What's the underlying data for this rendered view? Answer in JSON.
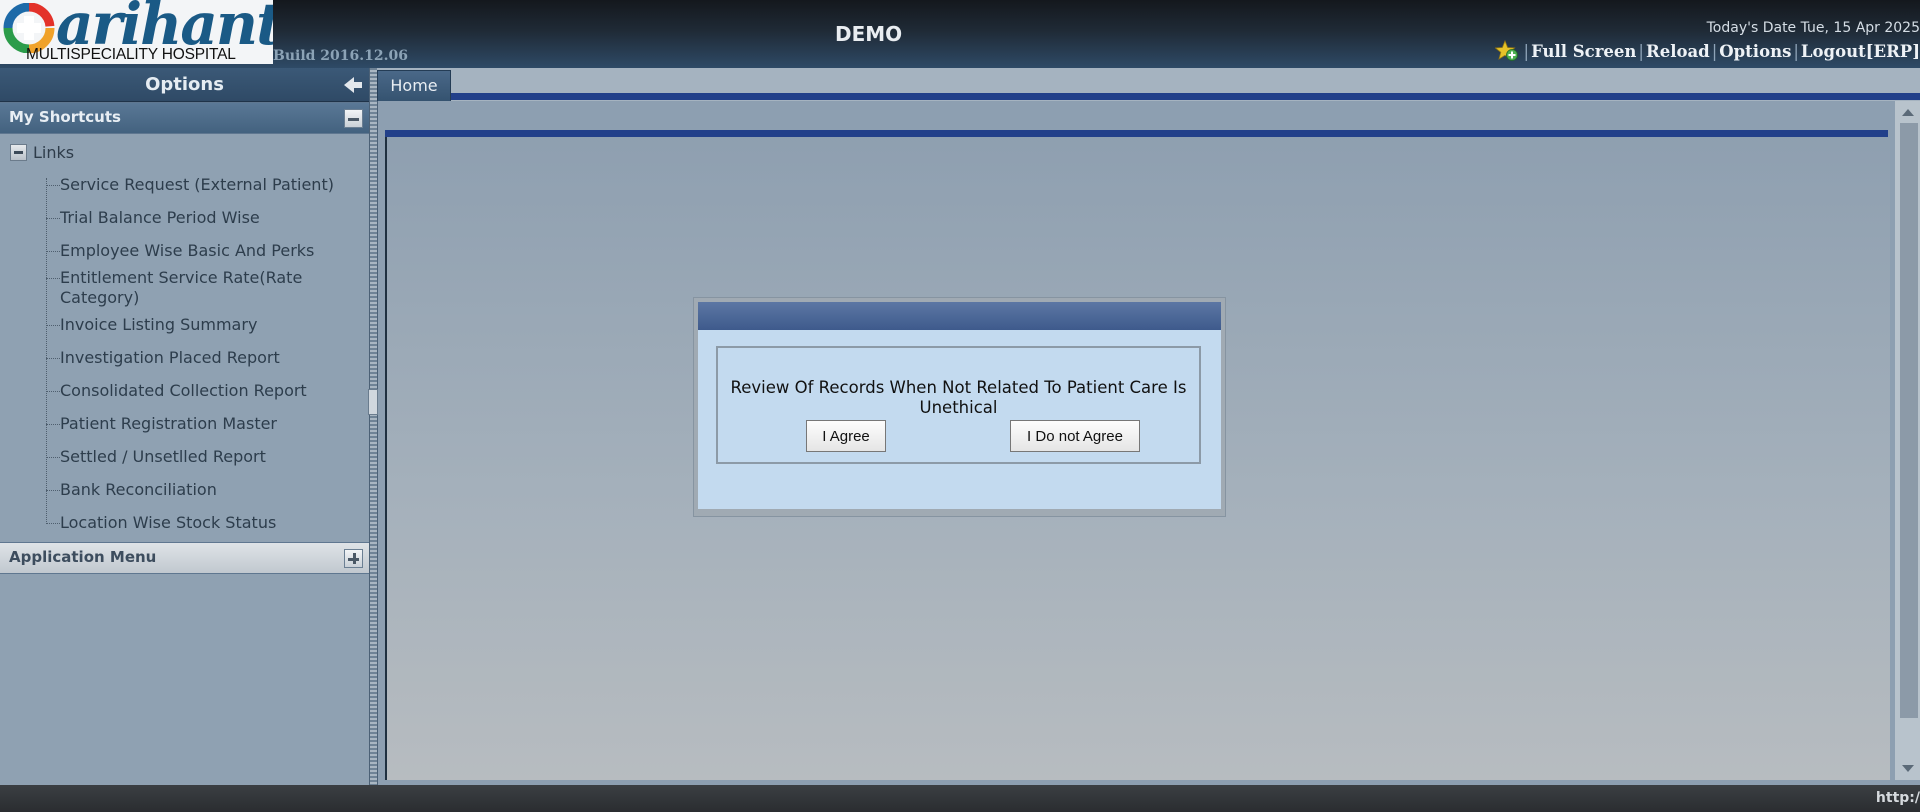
{
  "header": {
    "logo": {
      "word": "arihant",
      "subtitle": "MULTISPECIALITY HOSPITAL"
    },
    "build": "Build 2016.12.06",
    "site_title": "DEMO",
    "today": "Today's Date Tue, 15 Apr 2025",
    "links": [
      "Full Screen",
      "Reload",
      "Options",
      "Logout[ERP]"
    ]
  },
  "left_panel": {
    "title": "Options",
    "shortcuts_label": "My Shortcuts",
    "tree_root": "Links",
    "items": [
      "Service Request (External Patient)",
      "Trial Balance Period Wise",
      "Employee Wise Basic And Perks",
      "Entitlement Service Rate(Rate Category)",
      "Invoice Listing Summary",
      "Investigation Placed Report",
      "Consolidated Collection Report",
      "Patient Registration Master",
      "Settled / Unsetlled Report",
      "Bank Reconciliation",
      "Location Wise Stock Status"
    ],
    "app_menu_label": "Application Menu"
  },
  "main": {
    "tab": "Home"
  },
  "modal": {
    "message": "Review Of Records When Not Related To Patient Care Is Unethical",
    "agree": "I Agree",
    "disagree": "I Do not Agree"
  },
  "statusbar": {
    "url": "http:/"
  },
  "colors": {
    "header_bg": "#1f2a36",
    "panel_bg": "#8fa1b2",
    "accent_blue": "#22408a",
    "modal_bg": "#c3daef"
  }
}
